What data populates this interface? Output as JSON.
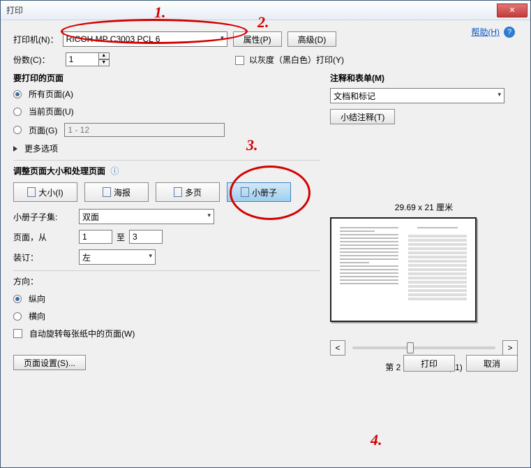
{
  "window_title": "打印",
  "close_glyph": "✕",
  "help_link": "帮助(H)",
  "printer_label": "打印机(N)：",
  "printer_value": "RICOH MP C3003 PCL 6",
  "properties_btn": "属性(P)",
  "advanced_btn": "高级(D)",
  "copies_label": "份数(C)：",
  "copies_value": "1",
  "grayscale_label": "以灰度（黑白色）打印(Y)",
  "pages_group_title": "要打印的页面",
  "radio_all": "所有页面(A)",
  "radio_current": "当前页面(U)",
  "radio_pages": "页面(G)",
  "pages_range_value": "1 - 12",
  "more_options": "更多选项",
  "resize_title": "调整页面大小和处理页面",
  "tab_size": "大小(I)",
  "tab_poster": "海报",
  "tab_multi": "多页",
  "tab_booklet": "小册子",
  "booklet_subset_label": "小册子子集:",
  "booklet_subset_value": "双面",
  "booklet_pages_label": "页面，从",
  "booklet_from": "1",
  "booklet_to_label": "至",
  "booklet_to": "3",
  "binding_label": "装订：",
  "binding_value": "左",
  "orient_label": "方向：",
  "orient_portrait": "纵向",
  "orient_landscape": "横向",
  "auto_rotate": "自动旋转每张纸中的页面(W)",
  "comments_title": "注释和表单(M)",
  "comments_value": "文档和标记",
  "summarize_btn": "小结注释(T)",
  "paper_dims": "29.69 x 21 厘米",
  "nav_prev": "<",
  "nav_next": ">",
  "page_status": "第 2 页，共 6 页 (11)",
  "page_setup_btn": "页面设置(S)...",
  "print_btn": "打印",
  "cancel_btn": "取消",
  "annotations": {
    "a1": "1.",
    "a2": "2.",
    "a3": "3.",
    "a4": "4."
  },
  "icons": {
    "info": "ⓘ",
    "up": "▲",
    "down": "▼"
  }
}
